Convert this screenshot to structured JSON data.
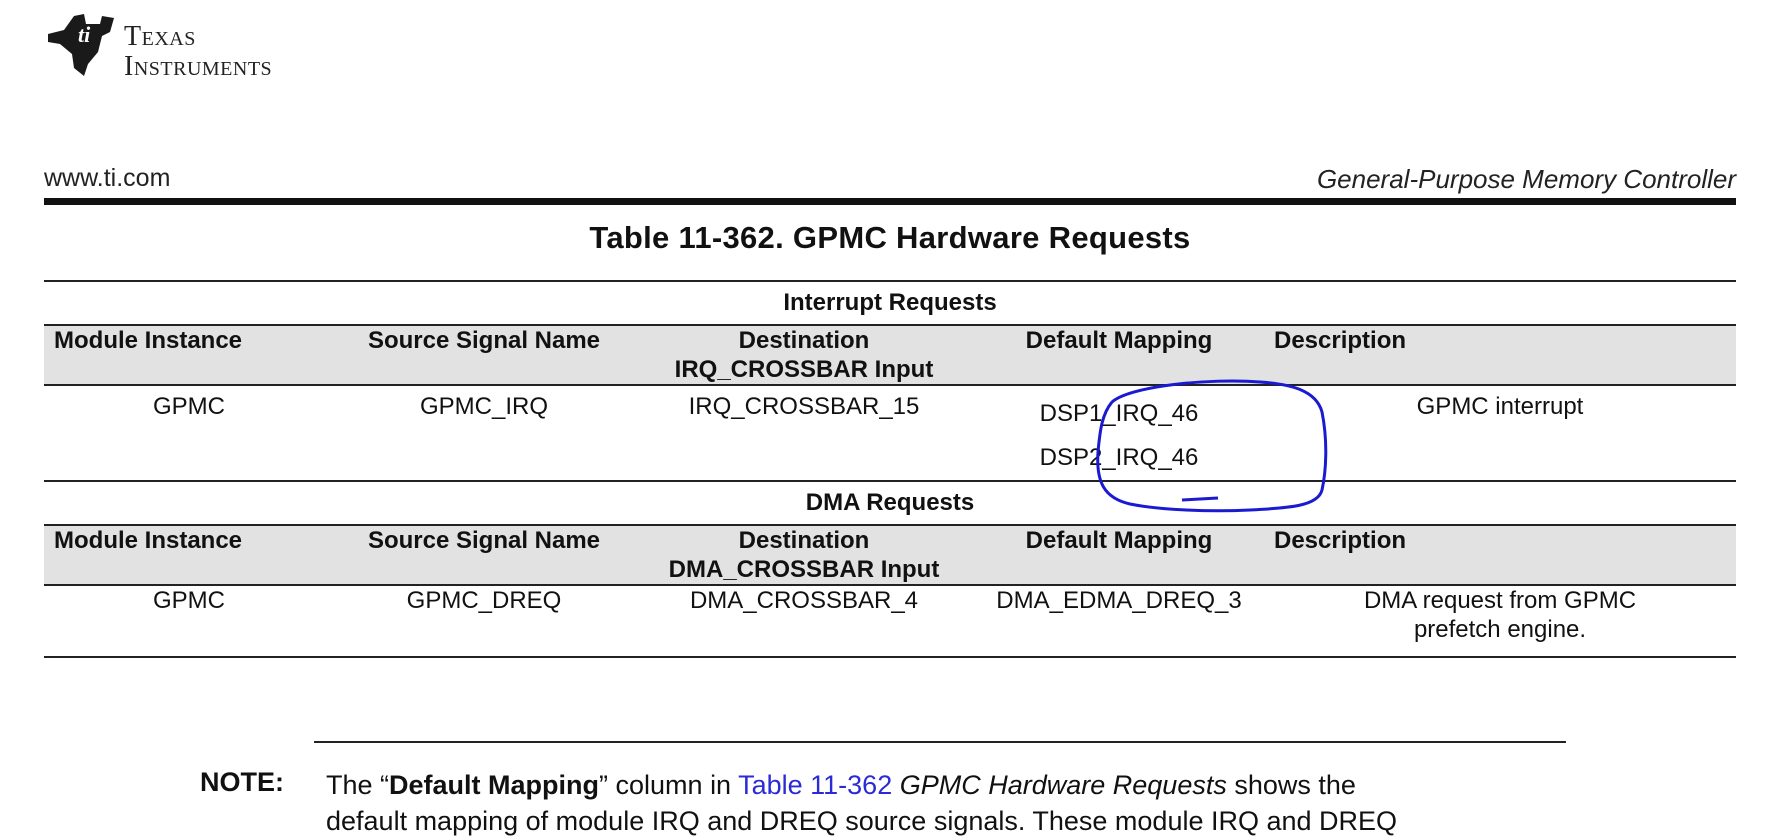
{
  "header": {
    "logo_line1": "Texas",
    "logo_line2": "Instruments",
    "url": "www.ti.com",
    "chapter": "General-Purpose Memory Controller"
  },
  "table": {
    "title": "Table 11-362. GPMC Hardware Requests",
    "interrupt_section": {
      "label": "Interrupt Requests",
      "headers": [
        "Module Instance",
        "Source Signal Name",
        "Destination",
        "Default Mapping",
        "Description"
      ],
      "dest_header_sub": "IRQ_CROSSBAR Input",
      "row": {
        "module": "GPMC",
        "source": "GPMC_IRQ",
        "destination": "IRQ_CROSSBAR_15",
        "mapping": [
          "DSP1_IRQ_46",
          "DSP2_IRQ_46"
        ],
        "description": "GPMC interrupt"
      }
    },
    "dma_section": {
      "label": "DMA Requests",
      "headers": [
        "Module Instance",
        "Source Signal Name",
        "Destination",
        "Default Mapping",
        "Description"
      ],
      "dest_header_sub": "DMA_CROSSBAR Input",
      "row": {
        "module": "GPMC",
        "source": "GPMC_DREQ",
        "destination": "DMA_CROSSBAR_4",
        "mapping": "DMA_EDMA_DREQ_3",
        "description_line1": "DMA request from GPMC",
        "description_line2": "prefetch engine."
      }
    }
  },
  "note": {
    "label": "NOTE:",
    "t1": "The “",
    "bold": "Default Mapping",
    "t2": "” column in ",
    "link": "Table 11-362",
    "t3": " ",
    "italic": "GPMC Hardware Requests",
    "t4": " shows the",
    "line2": "default mapping of module IRQ and DREQ source signals. These module IRQ and DREQ"
  },
  "colors": {
    "annotation": "#1a1ad0",
    "header_bg": "#e2e2e2",
    "link": "#2a2ad6"
  }
}
